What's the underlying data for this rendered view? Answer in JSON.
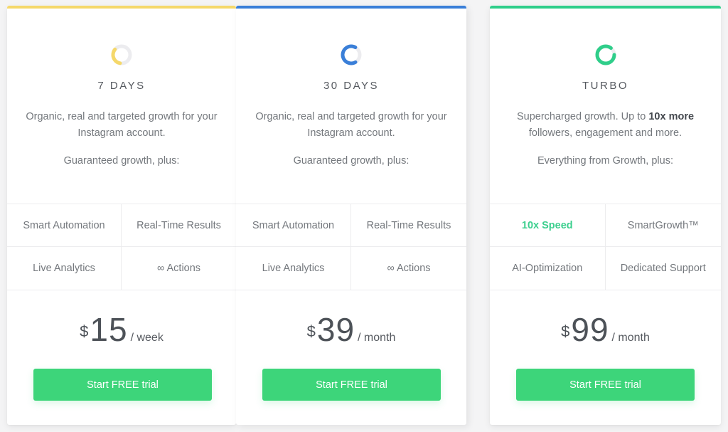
{
  "plans": [
    {
      "name": "7 DAYS",
      "accent_color": "#f5d86a",
      "icon": "donut-progress-icon",
      "icon_progress": 0.33,
      "description": "Organic, real and targeted growth for your Instagram account.",
      "subheading": "Guaranteed growth, plus:",
      "features": [
        "Smart Automation",
        "Real-Time Results",
        "Live Analytics",
        "∞ Actions"
      ],
      "currency": "$",
      "price": "15",
      "period": "/ week",
      "cta_label": "Start FREE trial"
    },
    {
      "name": "30 DAYS",
      "accent_color": "#3a7fd8",
      "icon": "donut-progress-icon",
      "icon_progress": 0.66,
      "description": "Organic, real and targeted growth for your Instagram account.",
      "subheading": "Guaranteed growth, plus:",
      "features": [
        "Smart Automation",
        "Real-Time Results",
        "Live Analytics",
        "∞ Actions"
      ],
      "currency": "$",
      "price": "39",
      "period": "/ month",
      "cta_label": "Start FREE trial"
    },
    {
      "name": "TURBO",
      "accent_color": "#2fce8a",
      "icon": "donut-progress-icon",
      "icon_progress": 0.85,
      "description_plain": "Supercharged growth. Up to ",
      "description_bold": "10x more",
      "description_tail": " followers, engagement and more.",
      "subheading": "Everything from Growth, plus:",
      "features": [
        "10x Speed",
        "SmartGrowth™",
        "AI-Optimization",
        "Dedicated Support"
      ],
      "highlight_feature_index": 0,
      "currency": "$",
      "price": "99",
      "period": "/ month",
      "cta_label": "Start FREE trial"
    }
  ],
  "colors": {
    "cta_green": "#3dd57a",
    "highlight_green": "#3ccf8e",
    "icon_track": "#ececef"
  }
}
